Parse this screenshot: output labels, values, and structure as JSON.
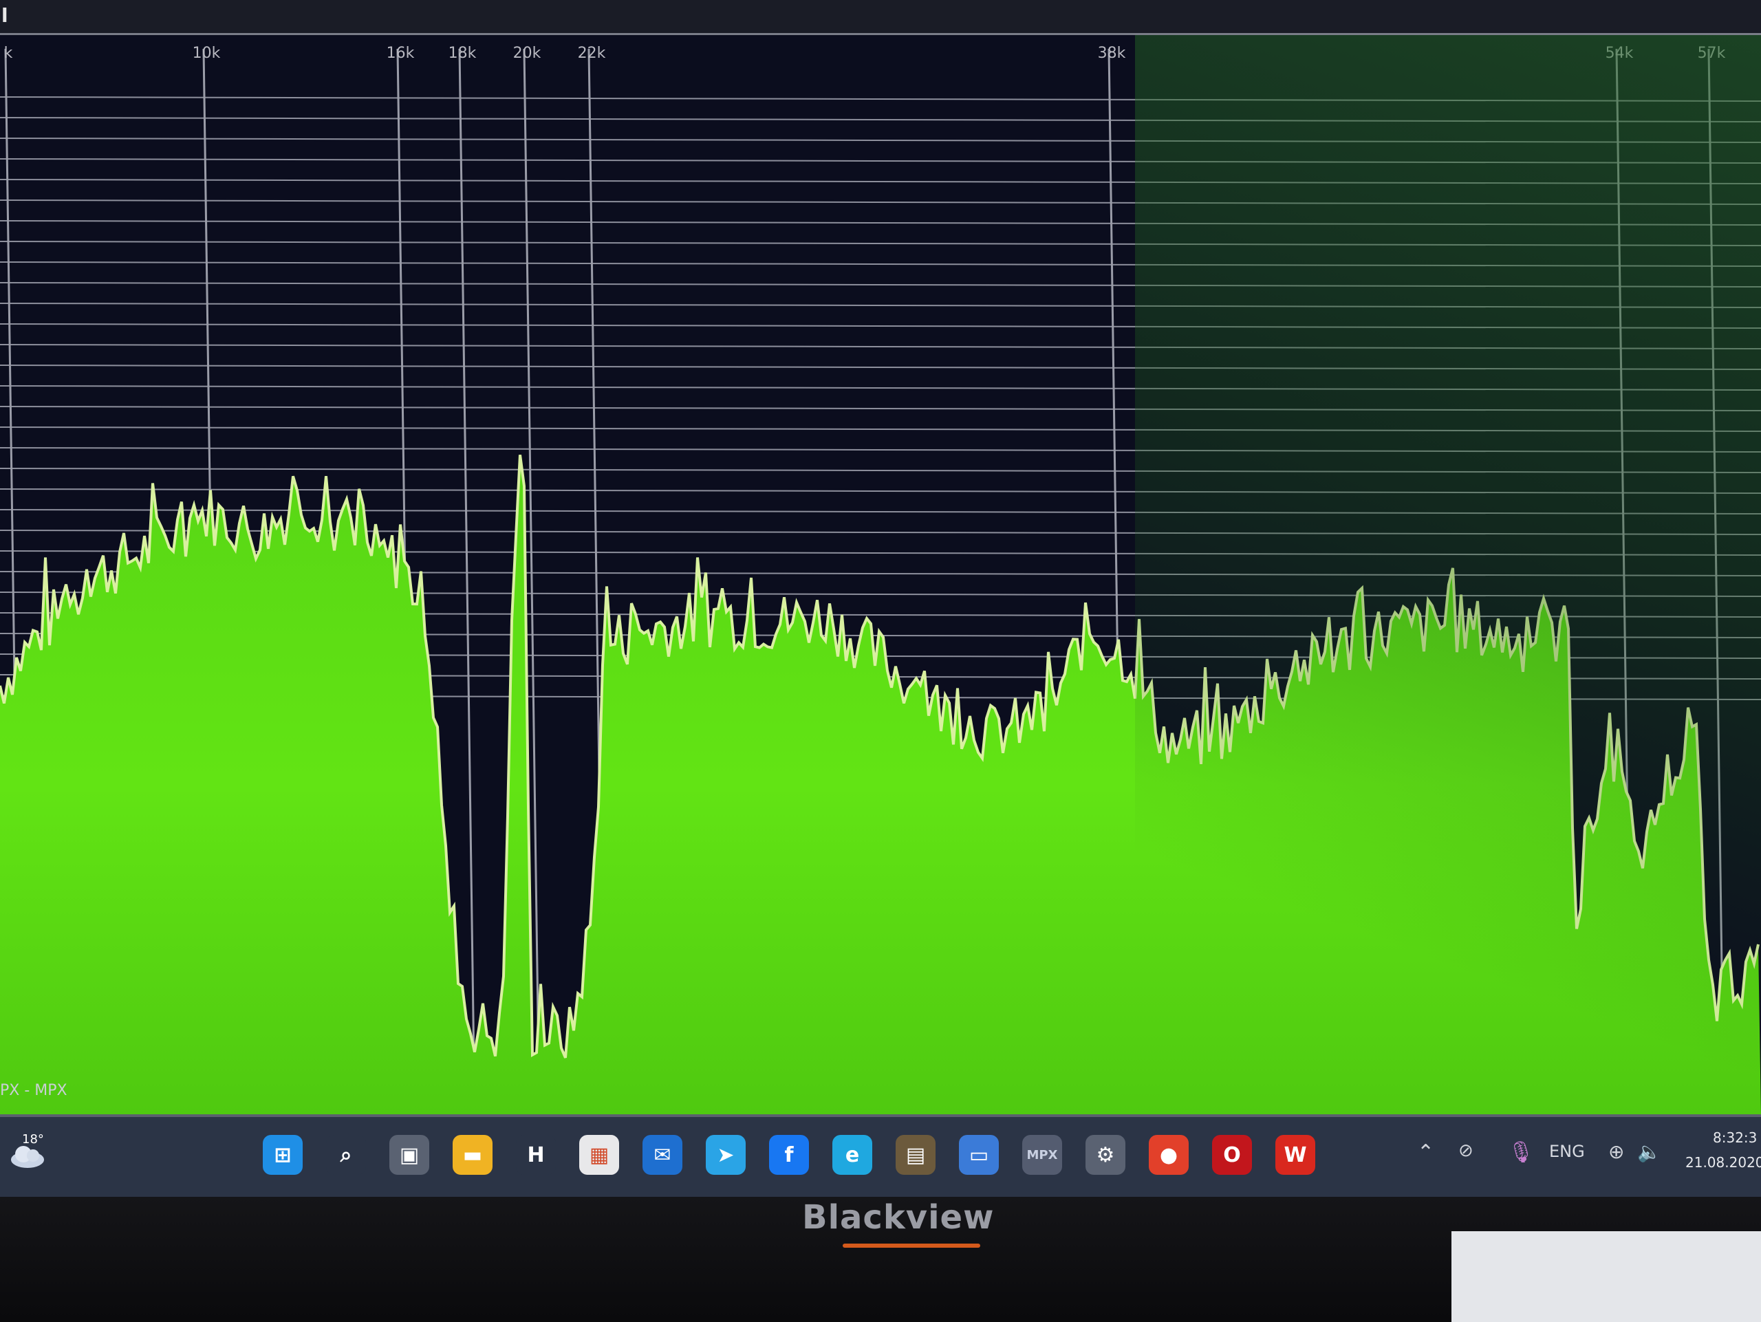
{
  "window": {
    "title_glyph": "l"
  },
  "spectrum": {
    "frequency_markers": [
      "k",
      "10k",
      "16k",
      "18k",
      "20k",
      "22k",
      "38k",
      "54k",
      "57k"
    ],
    "channel_label": "PX - MPX",
    "colors": {
      "background": "#0b0d1e",
      "fill": "#5fe012",
      "grid": "#8d8f9c",
      "peak_line": "#d9f0a0"
    }
  },
  "taskbar": {
    "weather_temp": "18°",
    "pinned_apps": [
      {
        "icon": "windows-start-icon",
        "glyph": "⊞"
      },
      {
        "icon": "search-icon",
        "glyph": "⌕"
      },
      {
        "icon": "task-view-icon",
        "glyph": "▣"
      },
      {
        "icon": "file-explorer-icon",
        "glyph": "▬"
      },
      {
        "icon": "h-app-icon",
        "glyph": "H"
      },
      {
        "icon": "store-icon",
        "glyph": "▦"
      },
      {
        "icon": "mail-icon",
        "glyph": "✉"
      },
      {
        "icon": "telegram-icon",
        "glyph": "➤"
      },
      {
        "icon": "facebook-icon",
        "glyph": "f"
      },
      {
        "icon": "edge-icon",
        "glyph": "e"
      },
      {
        "icon": "calculator-icon",
        "glyph": "▤"
      },
      {
        "icon": "folder-icon",
        "glyph": "▭"
      },
      {
        "icon": "mpx-app-icon",
        "glyph": "MPX"
      },
      {
        "icon": "settings-icon",
        "glyph": "⚙"
      },
      {
        "icon": "screen-recorder-icon",
        "glyph": "●"
      },
      {
        "icon": "opera-icon",
        "glyph": "O"
      },
      {
        "icon": "office-icon",
        "glyph": "W"
      }
    ],
    "tray": {
      "language": "ENG",
      "time": "8:32:3",
      "date": "21.08.2020"
    }
  },
  "monitor": {
    "brand": "Blackview"
  }
}
